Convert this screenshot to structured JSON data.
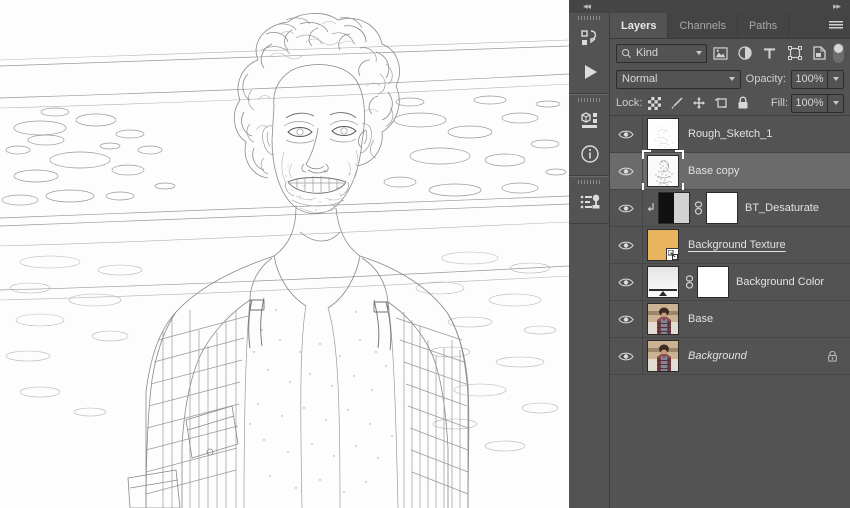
{
  "window": {
    "collapse_left_icon": "double-chevron-left",
    "collapse_right_icon": "double-chevron-right"
  },
  "toolrail": {
    "items": [
      {
        "name": "actions-icon",
        "label": "Actions"
      },
      {
        "name": "play-icon",
        "label": "Play"
      },
      {
        "name": "properties-icon",
        "label": "Properties"
      },
      {
        "name": "info-icon",
        "label": "Info"
      },
      {
        "name": "libraries-icon",
        "label": "Libraries"
      }
    ]
  },
  "panel": {
    "tabs": [
      {
        "label": "Layers",
        "active": true
      },
      {
        "label": "Channels",
        "active": false
      },
      {
        "label": "Paths",
        "active": false
      }
    ],
    "menu_icon": "hamburger-menu-icon",
    "filter": {
      "search_icon": "magnifier-icon",
      "kind_label": "Kind",
      "icons": [
        "filter-pixel-icon",
        "filter-adjustment-icon",
        "filter-type-icon",
        "filter-shape-icon",
        "filter-smartobject-icon"
      ],
      "toggle_name": "filter-enable-toggle"
    },
    "blend": {
      "mode": "Normal",
      "opacity_label": "Opacity:",
      "opacity_value": "100%"
    },
    "lock": {
      "label": "Lock:",
      "icons": [
        "lock-transparent-pixels-icon",
        "lock-image-pixels-icon",
        "lock-position-icon",
        "lock-artboard-icon",
        "lock-all-icon"
      ],
      "fill_label": "Fill:",
      "fill_value": "100%"
    },
    "layers": [
      {
        "name": "Rough_Sketch_1",
        "visible": true,
        "selected": false,
        "thumb": "sketch-light",
        "style": "normal"
      },
      {
        "name": "Base copy",
        "visible": true,
        "selected": true,
        "thumb": "sketch-dense",
        "style": "normal"
      },
      {
        "name": "BT_Desaturate",
        "visible": true,
        "selected": false,
        "thumb": "adjustment-bw",
        "clipped": true,
        "linked": true,
        "mask": "white",
        "style": "normal"
      },
      {
        "name": "Background Texture ",
        "visible": true,
        "selected": false,
        "thumb": "texture-tan",
        "smart_object": true,
        "style": "underline"
      },
      {
        "name": "Background Color",
        "visible": true,
        "selected": false,
        "thumb": "gradient-fill",
        "linked": true,
        "mask": "white",
        "style": "normal"
      },
      {
        "name": "Base",
        "visible": true,
        "selected": false,
        "thumb": "photo",
        "style": "normal"
      },
      {
        "name": "Background",
        "visible": true,
        "selected": false,
        "thumb": "photo",
        "locked": true,
        "style": "italic"
      }
    ]
  },
  "canvas": {
    "artwork_name": "pencil-sketch-portrait",
    "description": "Pencil sketch line-art of a smiling curly-haired man in a plaid shirt over a desert background"
  },
  "colors": {
    "panel_bg": "#535353",
    "panel_dark": "#444444",
    "row_selected": "#6b6b6b",
    "text": "#e2e2e2",
    "text_dim": "#a8a8a8",
    "texture_tan": "#e8b55e",
    "canvas_bg": "#fdfdfd"
  }
}
